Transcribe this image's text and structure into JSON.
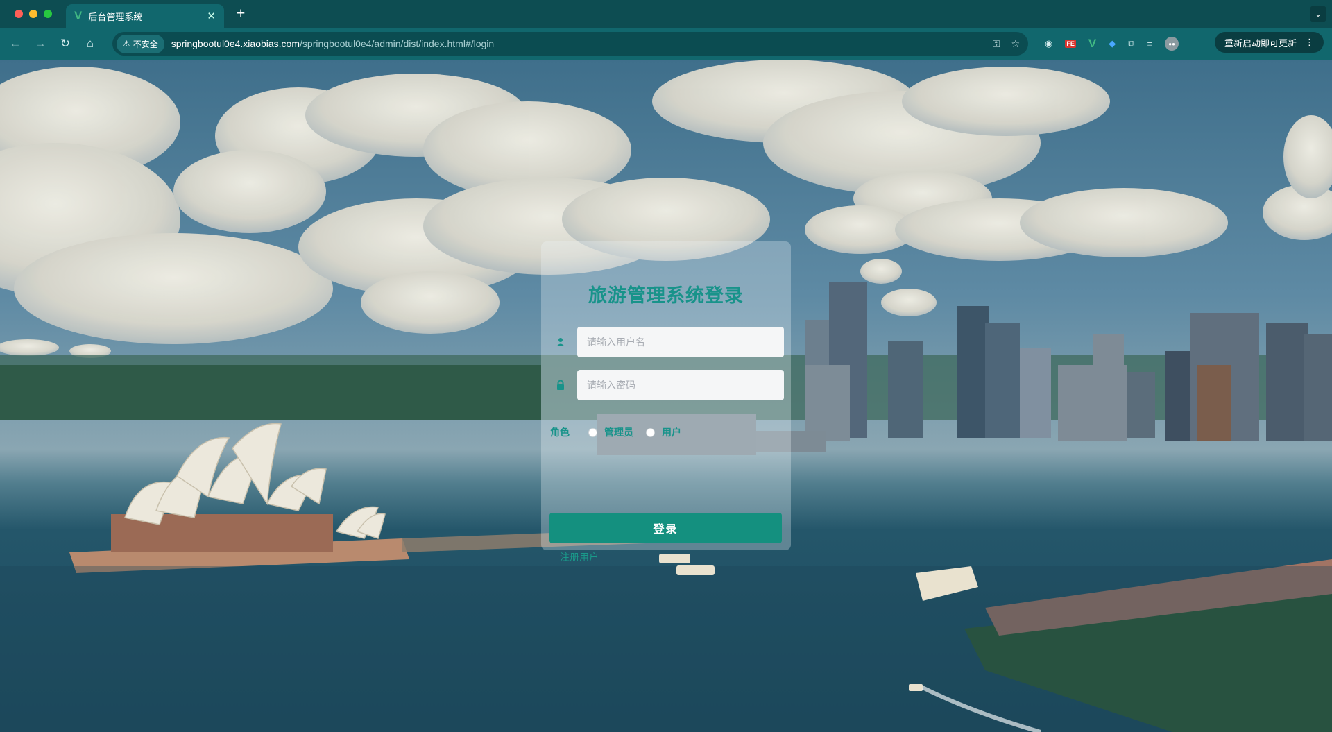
{
  "browser": {
    "tab_title": "后台管理系统",
    "tab_favicon": "V",
    "security_label": "不安全",
    "url_host": "springbootul0e4.xiaobias.com",
    "url_path": "/springbootul0e4/admin/dist/index.html#/login",
    "update_button": "重新启动即可更新",
    "colors": {
      "chrome_dark": "#0d4d52",
      "chrome_tab": "#11676d",
      "vue_green": "#41b883"
    }
  },
  "login": {
    "title": "旅游管理系统登录",
    "username_placeholder": "请输入用户名",
    "password_placeholder": "请输入密码",
    "role_label": "角色",
    "roles": [
      "管理员",
      "用户"
    ],
    "selected_role": null,
    "login_button": "登录",
    "register_link": "注册用户",
    "accent_color": "#18938a"
  }
}
